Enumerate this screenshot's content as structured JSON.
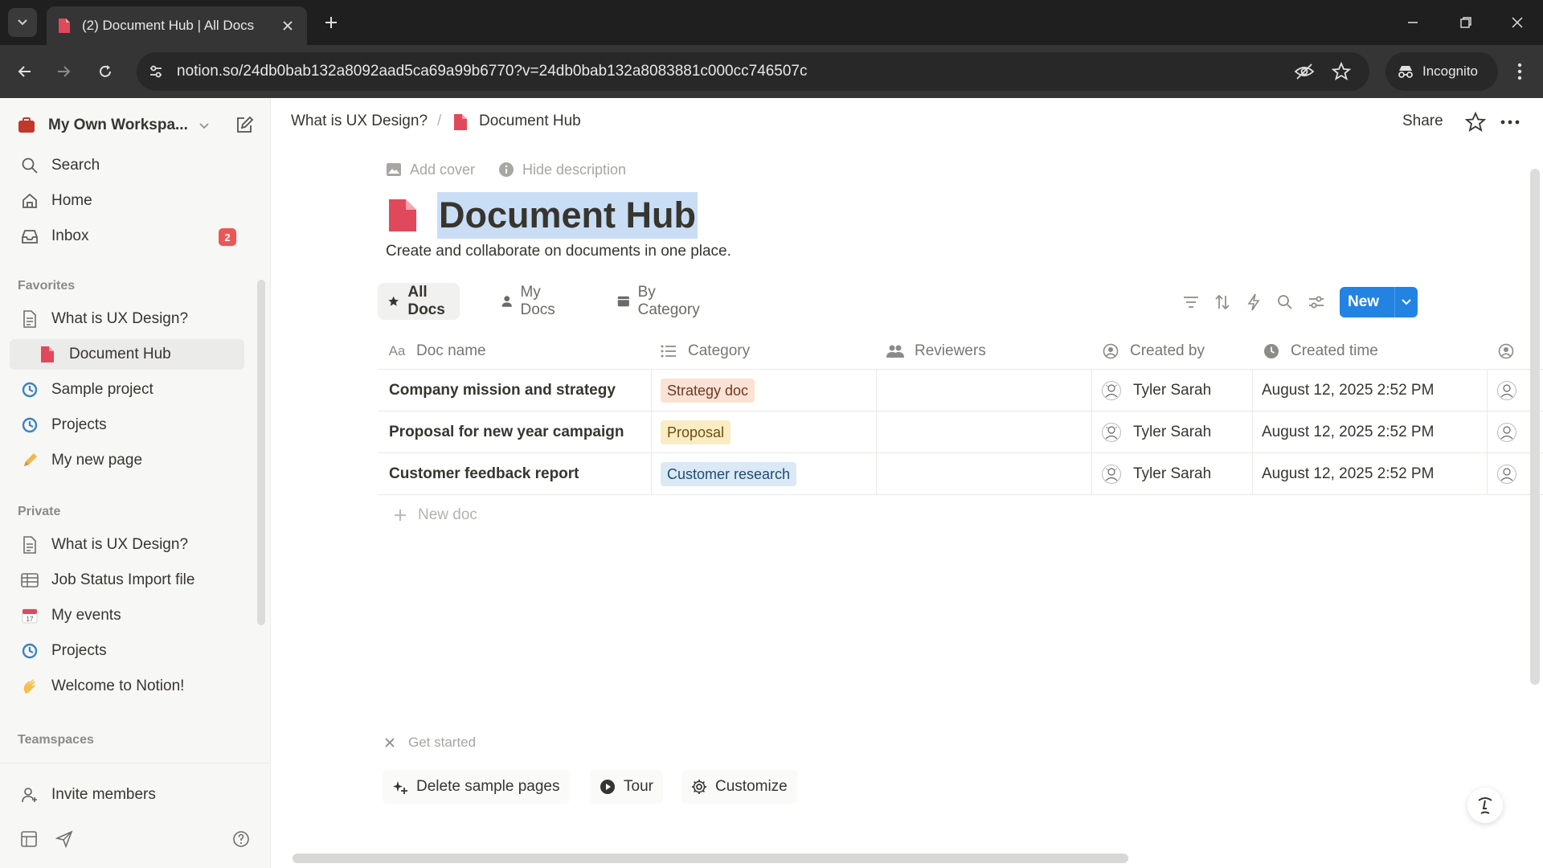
{
  "browser": {
    "tab_title": "(2) Document Hub | All Docs",
    "url": "notion.so/24db0bab132a8092aad5ca69a99b6770?v=24db0bab132a8083881c000cc746507c",
    "incognito_label": "Incognito"
  },
  "sidebar": {
    "workspace_name": "My Own Workspa...",
    "top_items": [
      {
        "label": "Search",
        "icon": "search-icon"
      },
      {
        "label": "Home",
        "icon": "home-icon"
      },
      {
        "label": "Inbox",
        "icon": "inbox-icon",
        "badge": "2"
      }
    ],
    "favorites_header": "Favorites",
    "favorites": [
      {
        "label": "What is UX Design?",
        "icon": "page-icon"
      },
      {
        "label": "Document Hub",
        "icon": "document-hub-icon"
      },
      {
        "label": "Sample project",
        "icon": "project-icon"
      },
      {
        "label": "Projects",
        "icon": "project-icon"
      },
      {
        "label": "My new page",
        "icon": "pencil-icon"
      }
    ],
    "private_header": "Private",
    "private": [
      {
        "label": "What is UX Design?",
        "icon": "page-icon"
      },
      {
        "label": "Job Status Import file",
        "icon": "table-icon"
      },
      {
        "label": "My events",
        "icon": "calendar-icon"
      },
      {
        "label": "Projects",
        "icon": "project-icon"
      },
      {
        "label": "Welcome to Notion!",
        "icon": "wave-icon"
      }
    ],
    "teamspaces_header": "Teamspaces",
    "invite_label": "Invite members"
  },
  "topbar": {
    "breadcrumb": [
      "What is UX Design?",
      "Document Hub"
    ],
    "share_label": "Share"
  },
  "page": {
    "add_cover": "Add cover",
    "hide_description": "Hide description",
    "title": "Document Hub",
    "description": "Create and collaborate on documents in one place."
  },
  "views": {
    "tabs": [
      "All Docs",
      "My Docs",
      "By Category"
    ],
    "active": "All Docs",
    "new_label": "New"
  },
  "table": {
    "columns": [
      "Doc name",
      "Category",
      "Reviewers",
      "Created by",
      "Created time"
    ],
    "rows": [
      {
        "name": "Company mission and strategy",
        "category": "Strategy doc",
        "category_color": "#fbe2d5",
        "reviewers": "",
        "created_by": "Tyler Sarah",
        "created_time": "August 12, 2025 2:52 PM"
      },
      {
        "name": "Proposal for new year campaign",
        "category": "Proposal",
        "category_color": "#fbecc4",
        "reviewers": "",
        "created_by": "Tyler Sarah",
        "created_time": "August 12, 2025 2:52 PM"
      },
      {
        "name": "Customer feedback report",
        "category": "Customer research",
        "category_color": "#dbe9f6",
        "reviewers": "",
        "created_by": "Tyler Sarah",
        "created_time": "August 12, 2025 2:52 PM"
      }
    ],
    "new_row_label": "New doc"
  },
  "get_started": {
    "label": "Get started",
    "actions": [
      "Delete sample pages",
      "Tour",
      "Customize"
    ]
  },
  "colors": {
    "accent": "#2383e2",
    "badge": "#eb5757",
    "title_highlight": "#c9def5"
  }
}
